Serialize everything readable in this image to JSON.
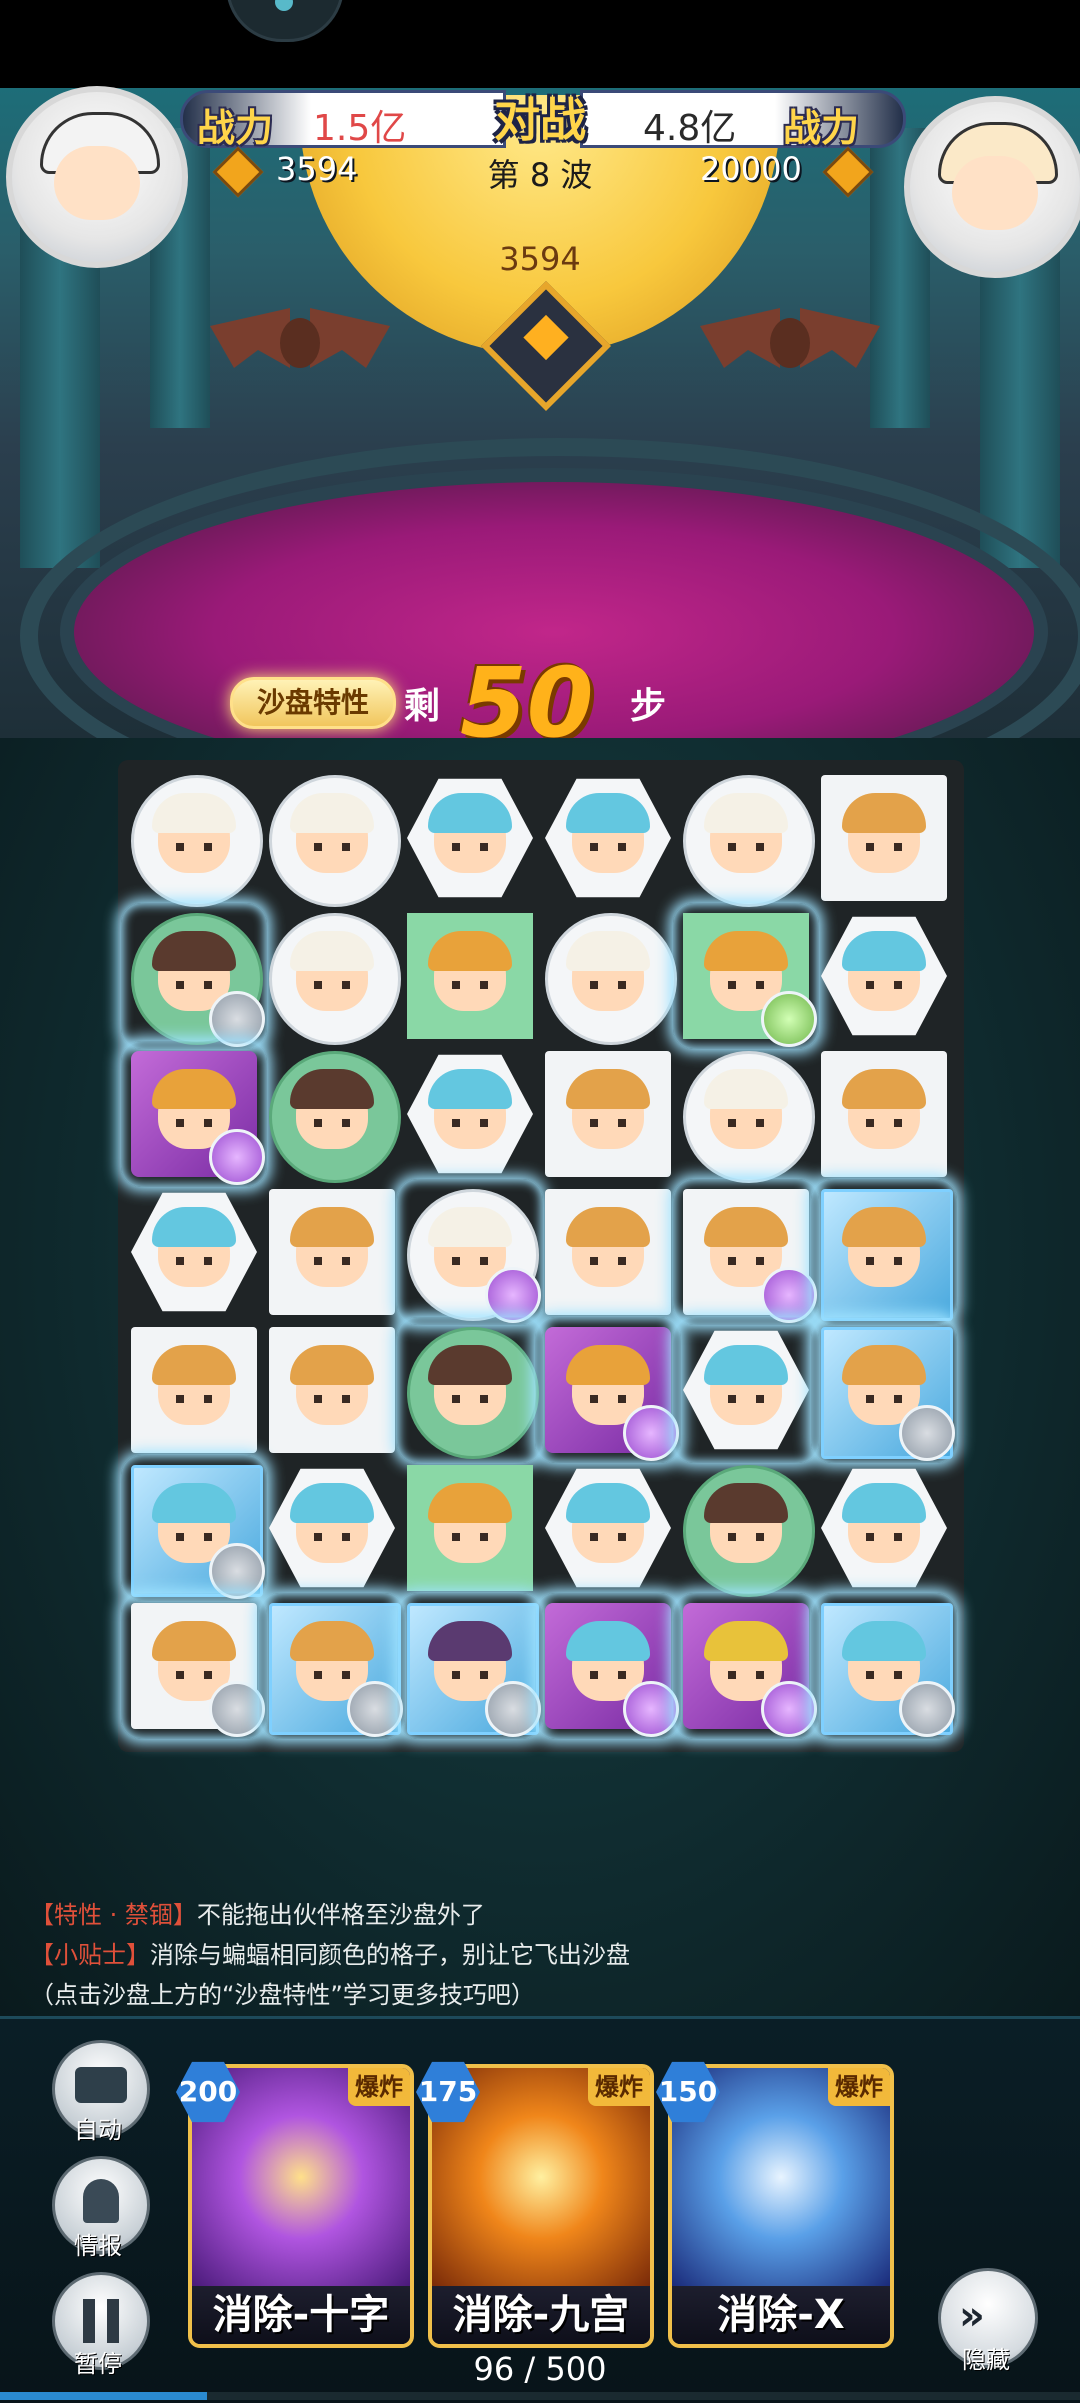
{
  "header": {
    "left_power_label": "战力",
    "left_power_value": "1.5亿",
    "vs_label": "对战",
    "right_power_value": "4.8亿",
    "right_power_label": "战力",
    "left_coins": "3594",
    "wave": "第 8 波",
    "right_coins": "20000",
    "center_score": "3594"
  },
  "steps": {
    "trait_button": "沙盘特性",
    "prefix": "剩",
    "count": "50",
    "suffix": "步"
  },
  "board": {
    "rows": 7,
    "cols": 6,
    "tiles": [
      [
        {
          "shape": "circle",
          "hair": "#f5f1e6",
          "lock": null,
          "bolt": false
        },
        {
          "shape": "circle",
          "hair": "#f5f1e6",
          "lock": null,
          "bolt": false
        },
        {
          "shape": "hex",
          "hair": "#63c7e0",
          "lock": null,
          "bolt": false
        },
        {
          "shape": "hex",
          "hair": "#63c7e0",
          "lock": null,
          "bolt": false
        },
        {
          "shape": "circle",
          "hair": "#f5f1e6",
          "lock": null,
          "bolt": false
        },
        {
          "shape": "square",
          "hair": "#e3a24a",
          "lock": null,
          "bolt": false
        }
      ],
      [
        {
          "shape": "greencircle",
          "hair": "#5a3a2e",
          "lock": "grey",
          "bolt": true
        },
        {
          "shape": "circle",
          "hair": "#f5f1e6",
          "lock": null,
          "bolt": false
        },
        {
          "shape": "green",
          "hair": "#e8a23a",
          "lock": null,
          "bolt": false
        },
        {
          "shape": "circle",
          "hair": "#f5f1e6",
          "lock": null,
          "bolt": false
        },
        {
          "shape": "green",
          "hair": "#e8a23a",
          "lock": "green",
          "bolt": true
        },
        {
          "shape": "hex",
          "hair": "#63c7e0",
          "lock": null,
          "bolt": false
        }
      ],
      [
        {
          "shape": "purple",
          "hair": "#e8a23a",
          "lock": "purple",
          "bolt": true
        },
        {
          "shape": "greencircle",
          "hair": "#5a3a2e",
          "lock": null,
          "bolt": false
        },
        {
          "shape": "hex",
          "hair": "#63c7e0",
          "lock": null,
          "bolt": false
        },
        {
          "shape": "square",
          "hair": "#e3a24a",
          "lock": null,
          "bolt": false
        },
        {
          "shape": "circle",
          "hair": "#f5f1e6",
          "lock": null,
          "bolt": false
        },
        {
          "shape": "square",
          "hair": "#e3a24a",
          "lock": null,
          "bolt": false
        }
      ],
      [
        {
          "shape": "hex",
          "hair": "#63c7e0",
          "lock": null,
          "bolt": false
        },
        {
          "shape": "square",
          "hair": "#e3a24a",
          "lock": null,
          "bolt": false
        },
        {
          "shape": "circle",
          "hair": "#f5f1e6",
          "lock": "purple",
          "bolt": true
        },
        {
          "shape": "square",
          "hair": "#e3a24a",
          "lock": null,
          "bolt": false
        },
        {
          "shape": "square",
          "hair": "#e3a24a",
          "lock": "purple",
          "bolt": true
        },
        {
          "shape": "ice",
          "hair": "#e3a24a",
          "lock": null,
          "bolt": true
        }
      ],
      [
        {
          "shape": "square",
          "hair": "#e3a24a",
          "lock": null,
          "bolt": false
        },
        {
          "shape": "square",
          "hair": "#e3a24a",
          "lock": null,
          "bolt": false
        },
        {
          "shape": "greencircle",
          "hair": "#5a3a2e",
          "lock": null,
          "bolt": true
        },
        {
          "shape": "purple",
          "hair": "#e8a23a",
          "lock": "purple",
          "bolt": true
        },
        {
          "shape": "hex",
          "hair": "#63c7e0",
          "lock": null,
          "bolt": true
        },
        {
          "shape": "ice",
          "hair": "#e3a24a",
          "lock": "grey",
          "bolt": true
        }
      ],
      [
        {
          "shape": "ice",
          "hair": "#63c7e0",
          "lock": "grey",
          "bolt": true
        },
        {
          "shape": "hex",
          "hair": "#63c7e0",
          "lock": null,
          "bolt": false
        },
        {
          "shape": "green",
          "hair": "#e8a23a",
          "lock": null,
          "bolt": false
        },
        {
          "shape": "hex",
          "hair": "#63c7e0",
          "lock": null,
          "bolt": false
        },
        {
          "shape": "greencircle",
          "hair": "#5a3a2e",
          "lock": null,
          "bolt": false
        },
        {
          "shape": "hex",
          "hair": "#63c7e0",
          "lock": null,
          "bolt": false
        }
      ],
      [
        {
          "shape": "square",
          "hair": "#e3a24a",
          "lock": "grey",
          "bolt": true
        },
        {
          "shape": "ice",
          "hair": "#e3a24a",
          "lock": "grey",
          "bolt": true
        },
        {
          "shape": "ice",
          "hair": "#5a3a70",
          "lock": "grey",
          "bolt": true
        },
        {
          "shape": "purple",
          "hair": "#63c7e0",
          "lock": "purple",
          "bolt": true
        },
        {
          "shape": "purple",
          "hair": "#e8c23a",
          "lock": "purple",
          "bolt": true
        },
        {
          "shape": "ice",
          "hair": "#63c7e0",
          "lock": "grey",
          "bolt": true
        }
      ]
    ]
  },
  "tips": {
    "line1_tag": "【特性 · 禁锢】",
    "line1_text": "不能拖出伙伴格至沙盘外了",
    "line2_tag": "【小贴士】",
    "line2_text": "消除与蝙蝠相同颜色的格子，别让它飞出沙盘",
    "line3_text": "（点击沙盘上方的“沙盘特性”学习更多技巧吧）"
  },
  "side_buttons": {
    "auto": "自动",
    "intel": "情报",
    "pause": "暂停"
  },
  "skills": [
    {
      "cost": "200",
      "tag": "爆炸",
      "name": "消除-十字",
      "color": "#8a3ac8"
    },
    {
      "cost": "175",
      "tag": "爆炸",
      "name": "消除-九宫",
      "color": "#d8721a"
    },
    {
      "cost": "150",
      "tag": "爆炸",
      "name": "消除-X",
      "color": "#3a78d8"
    }
  ],
  "hide_label": "隐藏",
  "progress": {
    "text": "96 / 500",
    "fraction": 0.192
  },
  "colors": {
    "accent": "#ffd54a",
    "steps": "#ffb21a",
    "tip_bracket": "#e0503a",
    "power_value": "#e04848",
    "vs_right_value": "#2a2a2a"
  }
}
